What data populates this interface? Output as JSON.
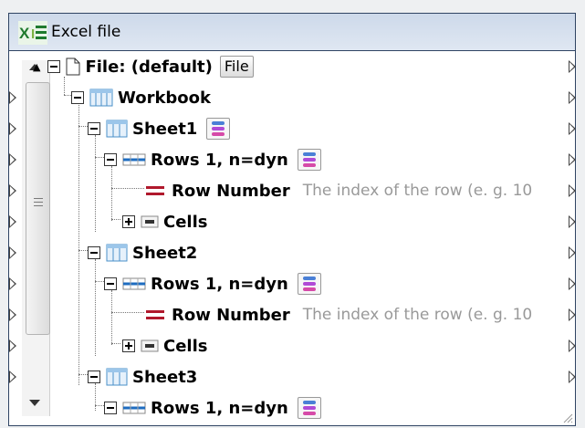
{
  "component": {
    "title": "Excel file",
    "file_row": {
      "label": "File: (default)",
      "button": "File"
    },
    "tree": [
      {
        "key": "workbook",
        "label": "Workbook"
      },
      {
        "key": "sheet1",
        "label": "Sheet1"
      },
      {
        "key": "rows1",
        "label": "Rows 1, n=dyn"
      },
      {
        "key": "rownum1",
        "label": "Row Number",
        "desc": "The index of the row (e. g. 10"
      },
      {
        "key": "cells1",
        "label": "Cells"
      },
      {
        "key": "sheet2",
        "label": "Sheet2"
      },
      {
        "key": "rows2",
        "label": "Rows 1, n=dyn"
      },
      {
        "key": "rownum2",
        "label": "Row Number",
        "desc": "The index of the row (e. g. 10"
      },
      {
        "key": "cells2",
        "label": "Cells"
      },
      {
        "key": "sheet3",
        "label": "Sheet3"
      },
      {
        "key": "rows3",
        "label": "Rows 1, n=dyn"
      }
    ]
  },
  "colors": {
    "title_bar": "#d4deec",
    "border": "#2f4463",
    "row_number_icon": "#b0182c",
    "excel_green": "#1f7a2e",
    "sheet_icon": "#4a90c8"
  },
  "icons": {
    "title": "excel-icon",
    "file": "document-icon",
    "workbook": "workbook-icon",
    "sheet": "sheet-icon",
    "rows": "rows-icon",
    "row_number": "equals-icon",
    "cells": "cells-icon",
    "dyn": "dynamic-rows-icon"
  }
}
